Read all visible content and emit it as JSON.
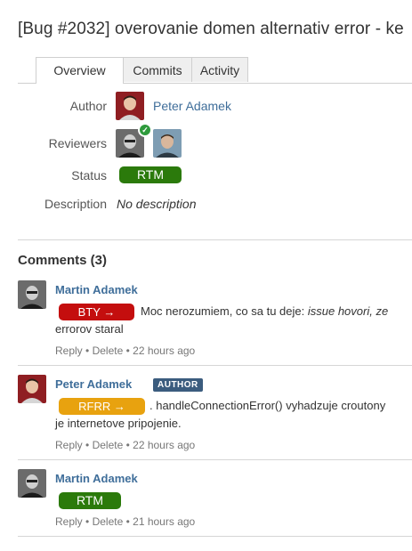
{
  "page": {
    "title": "[Bug #2032] overovanie domen alternativ error - ke"
  },
  "tabs": [
    {
      "label": "Overview",
      "active": true
    },
    {
      "label": "Commits",
      "active": false
    },
    {
      "label": "Activity",
      "active": false
    }
  ],
  "overview": {
    "author_label": "Author",
    "author_name": "Peter Adamek",
    "reviewers_label": "Reviewers",
    "status_label": "Status",
    "status_value": "RTM",
    "description_label": "Description",
    "description_value": "No description"
  },
  "comments": {
    "heading": "Comments (3)",
    "items": [
      {
        "author": "Martin Adamek",
        "badge": "BTY →",
        "text_line1_prefix": " Moc nerozumiem, co sa tu deje: ",
        "text_line1_italic": "issue hovori, ze",
        "text_line2": "errorov staral",
        "reply": "Reply",
        "delete": "Delete",
        "time": "22 hours ago"
      },
      {
        "author": "Peter Adamek",
        "author_tag": "AUTHOR",
        "badge": "RFRR →",
        "text_line1": ". handleConnectionError() vyhadzuje croutony",
        "text_line2": "je internetove pripojenie.",
        "reply": "Reply",
        "delete": "Delete",
        "time": "22 hours ago"
      },
      {
        "author": "Martin Adamek",
        "badge": "RTM",
        "reply": "Reply",
        "delete": "Delete",
        "time": "21 hours ago"
      }
    ]
  },
  "separator": "•",
  "colors": {
    "green": "#2b7a0b",
    "red": "#c40e0e",
    "orange": "#e8a20f",
    "link": "#3f6e9a",
    "author_badge": "#3b5c7e"
  }
}
